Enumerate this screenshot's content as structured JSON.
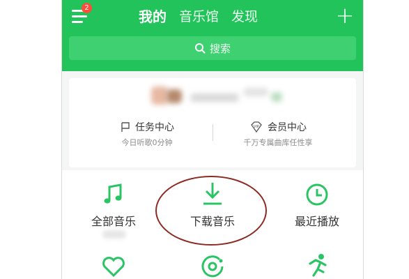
{
  "header": {
    "menu_badge": "2",
    "tabs": [
      {
        "label": "我的",
        "active": true
      },
      {
        "label": "音乐馆",
        "active": false
      },
      {
        "label": "发现",
        "active": false
      }
    ],
    "add_label": "+"
  },
  "search": {
    "placeholder": "搜索"
  },
  "profile_card": {
    "task_center": {
      "title": "任务中心",
      "subtitle": "今日听歌0分钟"
    },
    "vip_center": {
      "title": "会员中心",
      "subtitle": "千万专属曲库任性享"
    }
  },
  "grid": {
    "items": [
      {
        "label": "全部音乐",
        "icon": "music-note-icon"
      },
      {
        "label": "下载音乐",
        "icon": "download-icon"
      },
      {
        "label": "最近播放",
        "icon": "clock-icon"
      },
      {
        "label": "",
        "icon": "heart-icon"
      },
      {
        "label": "",
        "icon": "disc-icon"
      },
      {
        "label": "",
        "icon": "running-icon"
      }
    ]
  },
  "colors": {
    "brand_green": "#22c35a",
    "icon_green": "#2bc465",
    "annotation_red": "#8b2a22"
  }
}
